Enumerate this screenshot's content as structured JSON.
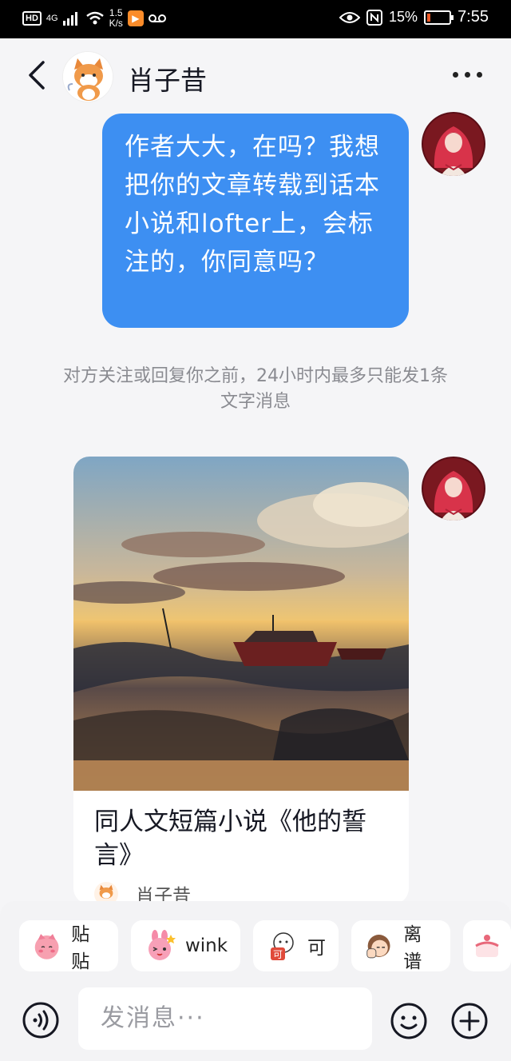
{
  "status_bar": {
    "hd": "HD",
    "network": "4G",
    "speed_value": "1.5",
    "speed_unit": "K/s",
    "battery": "15%",
    "time": "7:55"
  },
  "header": {
    "name": "肖子昔"
  },
  "messages": {
    "sent_text": "作者大大，在吗？我想把你的文章转载到话本小说和lofter上，会标注的，你同意吗？",
    "notice": "对方关注或回复你之前，24小时内最多只能发1条文字消息"
  },
  "card": {
    "title": "同人文短篇小说《他的誓言》",
    "author": "肖子昔"
  },
  "stickers": [
    {
      "label": "贴贴",
      "icon": "pink-blush-sticker-icon"
    },
    {
      "label": "wink",
      "icon": "pink-bunny-wink-sticker-icon"
    },
    {
      "label": "可",
      "icon": "stamp-ke-sticker-icon"
    },
    {
      "label": "离谱",
      "icon": "girl-facepalm-sticker-icon"
    }
  ],
  "input": {
    "placeholder": "发消息···"
  },
  "colors": {
    "bubble": "#3d8ff2",
    "background": "#f5f5f7"
  }
}
